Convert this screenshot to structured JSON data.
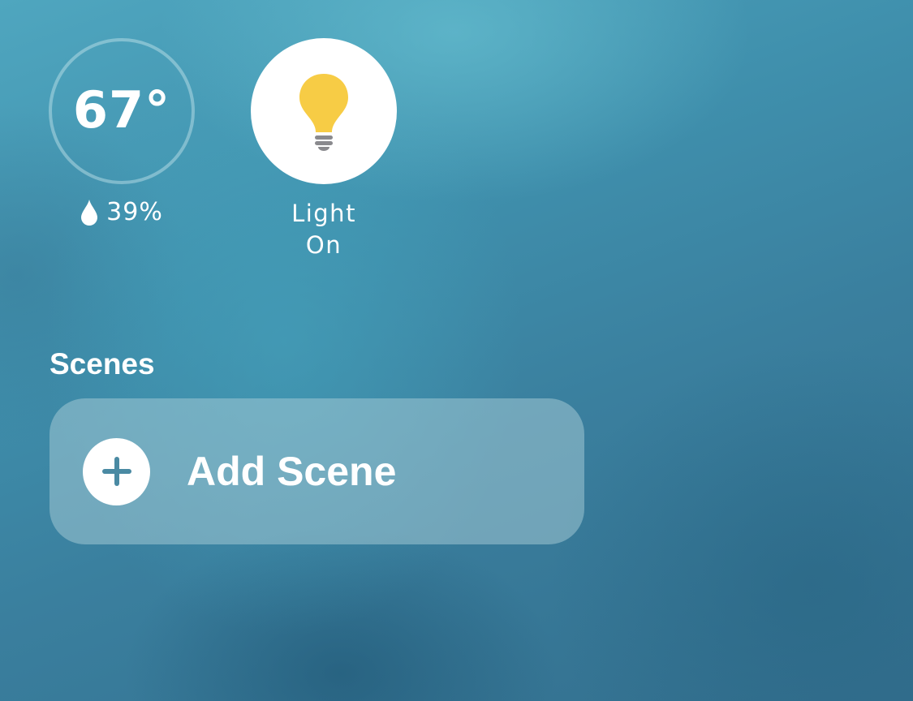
{
  "accessories": {
    "thermostat": {
      "temperature": "67°",
      "humidity": "39%",
      "humidity_icon": "water-drop-icon"
    },
    "light": {
      "icon": "light-bulb-icon",
      "name": "Light",
      "status": "On"
    }
  },
  "scenes": {
    "title": "Scenes",
    "add_button": {
      "label": "Add Scene",
      "icon": "plus-icon"
    }
  },
  "colors": {
    "bulb": "#f7cc45",
    "bulb_base": "#8a8a8e",
    "plus": "#4a8aa3"
  }
}
